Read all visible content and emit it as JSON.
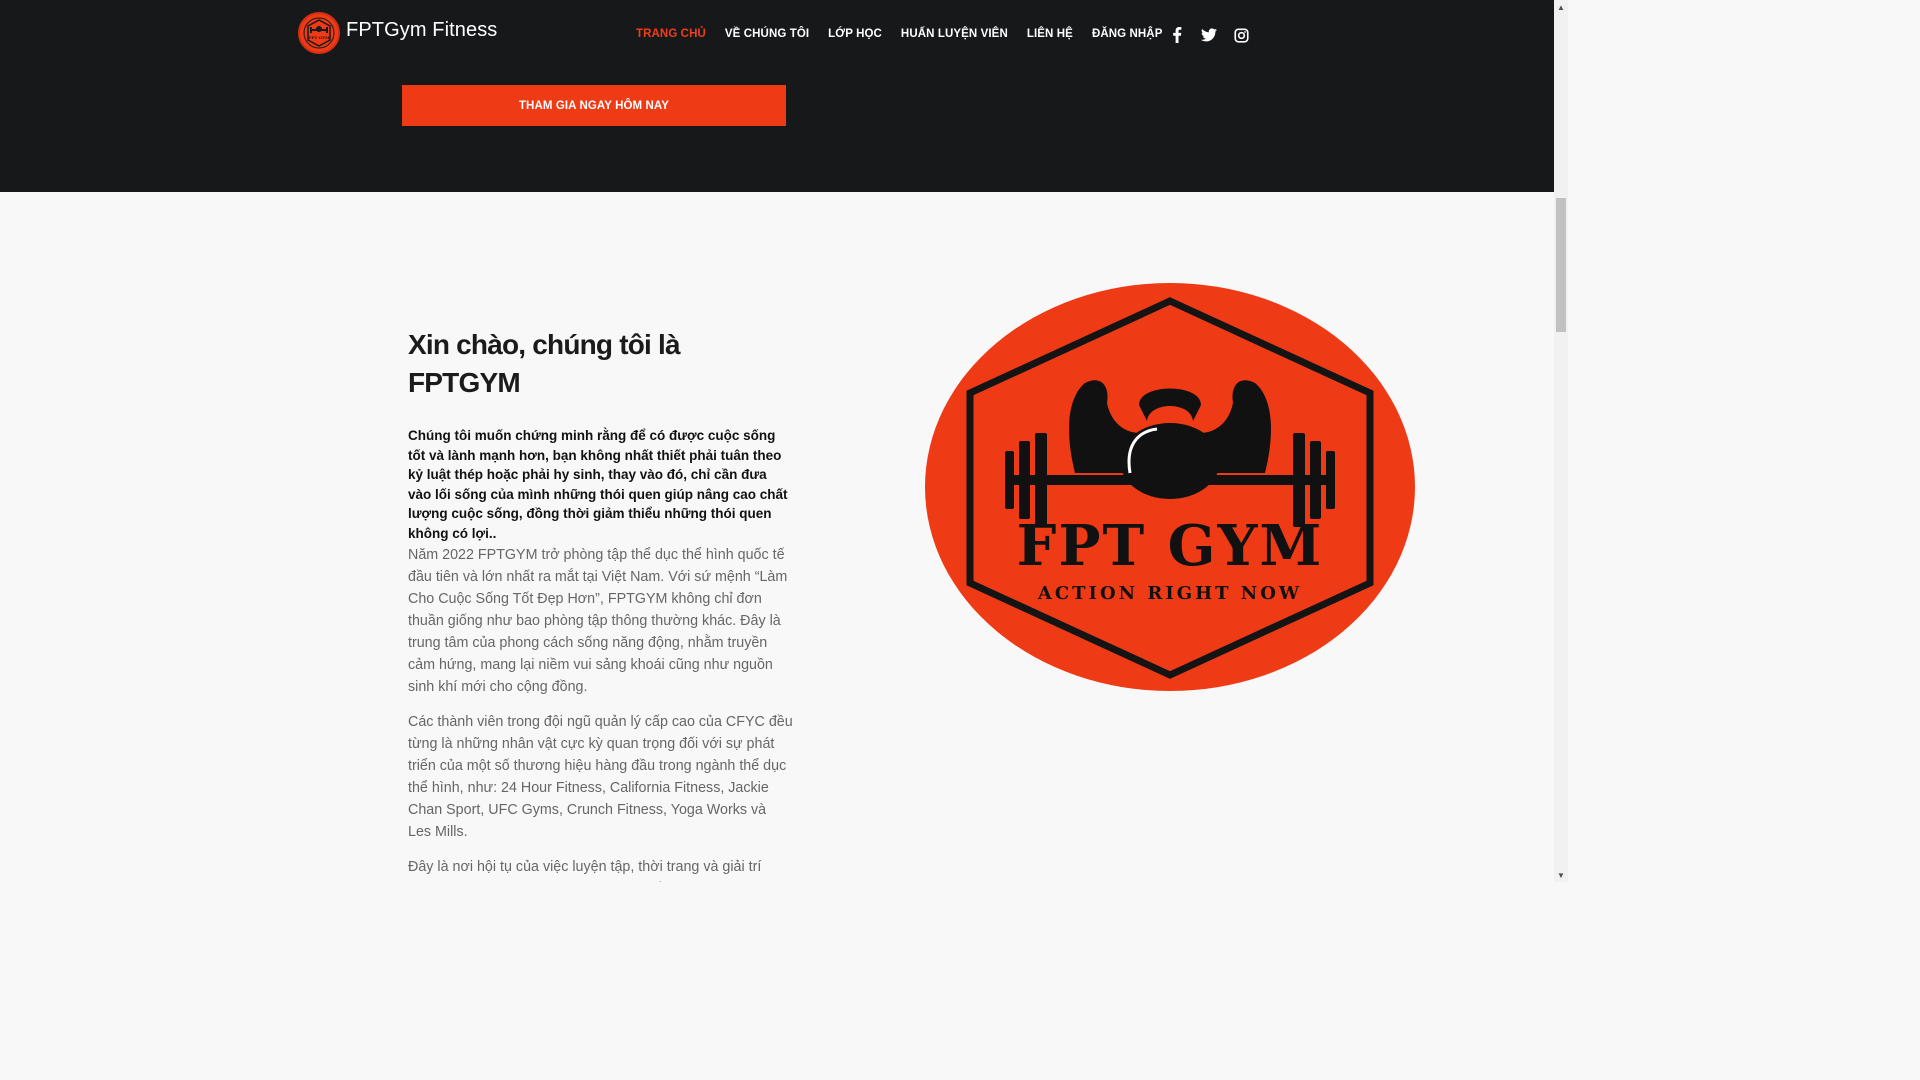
{
  "brand": {
    "name": "FPTGym Fitness",
    "badge_text": "FPT GYM"
  },
  "nav": {
    "items": [
      {
        "label": "TRANG CHỦ",
        "active": true
      },
      {
        "label": "VỀ CHÚNG TÔI",
        "active": false
      },
      {
        "label": "LỚP HỌC",
        "active": false
      },
      {
        "label": "HUẤN LUYỆN VIÊN",
        "active": false
      },
      {
        "label": "LIÊN HỆ",
        "active": false
      },
      {
        "label": "ĐĂNG NHẬP",
        "active": false
      }
    ],
    "social_icons": [
      "facebook-icon",
      "twitter-icon",
      "instagram-icon"
    ]
  },
  "hero": {
    "cta_label": "THAM GIA NGAY HÔM NAY"
  },
  "about": {
    "title": "Xin chào, chúng tôi là FPTGYM",
    "lead": "Chúng tôi muốn chứng minh rằng để có được cuộc sống tốt và lành mạnh hơn, bạn không nhất thiết phải tuân theo kỷ luật thép hoặc phải hy sinh, thay vào đó, chỉ cần đưa vào lối sống của mình những thói quen giúp nâng cao chất lượng cuộc sống, đồng thời giảm thiểu những thói quen không có lợi..",
    "paragraphs": [
      "Năm 2022 FPTGYM trở phòng tập thể dục thể hình quốc tế đầu tiên và lớn nhất ra mắt tại Việt Nam. Với sứ mệnh “Làm Cho Cuộc Sống Tốt Đẹp Hơn”, FPTGYM không chỉ đơn thuần giống như bao phòng tập thông thường khác. Đây là trung tâm của phong cách sống năng động, nhằm truyền cảm hứng, mang lại niềm vui sảng khoái cũng như nguồn sinh khí mới cho cộng đồng.",
      "Các thành viên trong đội ngũ quản lý cấp cao của CFYC đều từng là những nhân vật cực kỳ quan trọng đối với sự phát triển của một số thương hiệu hàng đầu trong ngành thể dục thể hình, như: 24 Hour Fitness, California Fitness, Jackie Chan Sport, UFC Gyms, Crunch Fitness, Yoga Works và Les Mills.",
      "Đây là nơi hội tụ của việc luyện tập, thời trang và giải trí trong một môi trường lành mạnh, tràn trề sinh lực. Từ âm"
    ]
  },
  "logo_image": {
    "text_main": "FPT GYM",
    "text_sub": "ACTION RIGHT NOW"
  },
  "colors": {
    "accent": "#ef3a16",
    "dark": "#17181a",
    "page_bg": "#f8f8f8"
  }
}
